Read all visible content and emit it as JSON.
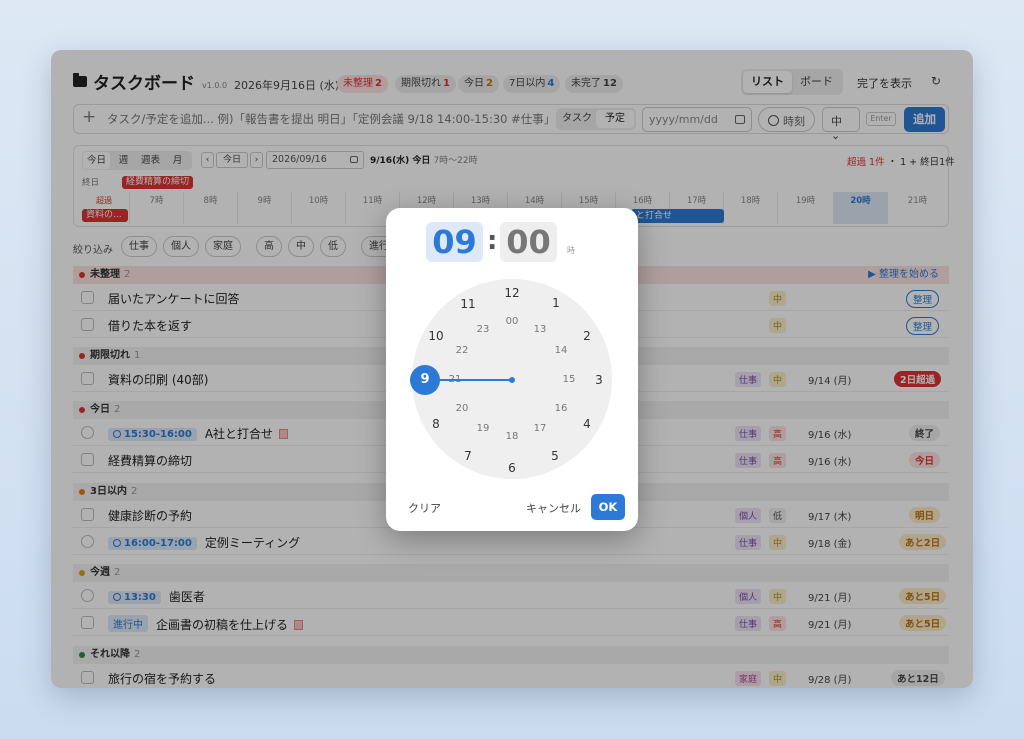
{
  "header": {
    "title": "タスクボード",
    "version": "v1.0.0",
    "date": "2026年9月16日 (水)",
    "chips": [
      {
        "label": "未整理",
        "count": "2"
      },
      {
        "label": "期限切れ",
        "count": "1"
      },
      {
        "label": "今日",
        "count": "2"
      },
      {
        "label": "7日以内",
        "count": "4"
      },
      {
        "label": "未完了",
        "count": "12"
      }
    ],
    "view_list": "リスト",
    "view_board": "ボード",
    "show_done": "完了を表示",
    "refresh_icon": "↻"
  },
  "addbar": {
    "plus": "+",
    "placeholder": "タスク/予定を追加... 例)「報告書を提出 明日」「定例会議 9/18 14:00-15:30 #仕事」",
    "type_task": "タスク",
    "type_event": "予定",
    "date_placeholder": "yyyy/mm/dd",
    "time_label": "時刻",
    "priority": "中",
    "enter_hint": "Enter",
    "add_button": "追加"
  },
  "timeline": {
    "tabs": [
      "今日",
      "週",
      "週表",
      "月"
    ],
    "prev": "‹",
    "today_btn": "今日",
    "next": "›",
    "date_value": "2026/09/16",
    "today_label": "9/16(水) 今日",
    "hours_range": "7時〜22時",
    "overdue_summary_red": "超過 1件",
    "overdue_summary_rest": " ・ 1 + 終日1件",
    "allday_label": "終日",
    "allday_event": "経費精算の締切",
    "overdue_label": "超過",
    "overdue_event": "資料の...",
    "hours": [
      "7時",
      "8時",
      "9時",
      "10時",
      "11時",
      "12時",
      "13時",
      "14時",
      "15時",
      "16時",
      "17時",
      "18時",
      "19時",
      "20時",
      "21時"
    ],
    "blue_event": "と打合せ"
  },
  "filters": {
    "label": "絞り込み",
    "chips": [
      "仕事",
      "個人",
      "家庭",
      "高",
      "中",
      "低",
      "進行"
    ]
  },
  "sections": [
    {
      "title": "未整理",
      "count": "2",
      "action": "▶ 整理を始める"
    },
    {
      "title": "期限切れ",
      "count": "1"
    },
    {
      "title": "今日",
      "count": "2"
    },
    {
      "title": "3日以内",
      "count": "2"
    },
    {
      "title": "今週",
      "count": "2"
    },
    {
      "title": "それ以降",
      "count": "2"
    }
  ],
  "rows": {
    "r1": {
      "title": "届いたアンケートに回答",
      "priority": "中",
      "badge": "整理"
    },
    "r2": {
      "title": "借りた本を返す",
      "priority": "中",
      "badge": "整理"
    },
    "r3": {
      "title": "資料の印刷 (40部)",
      "tag": "仕事",
      "priority": "中",
      "date": "9/14 (月)",
      "badge": "2日超過"
    },
    "r4": {
      "time": "15:30-16:00",
      "title": "A社と打合せ",
      "tag": "仕事",
      "priority": "高",
      "date": "9/16 (水)",
      "badge": "終了"
    },
    "r5": {
      "title": "経費精算の締切",
      "tag": "仕事",
      "priority": "高",
      "date": "9/16 (水)",
      "badge": "今日"
    },
    "r6": {
      "title": "健康診断の予約",
      "tag": "個人",
      "priority": "低",
      "date": "9/17 (木)",
      "badge": "明日"
    },
    "r7": {
      "time": "16:00-17:00",
      "title": "定例ミーティング",
      "tag": "仕事",
      "priority": "中",
      "date": "9/18 (金)",
      "badge": "あと2日"
    },
    "r8": {
      "time": "13:30",
      "title": "歯医者",
      "tag": "個人",
      "priority": "中",
      "date": "9/21 (月)",
      "badge": "あと5日"
    },
    "r9": {
      "status": "進行中",
      "title": "企画書の初稿を仕上げる",
      "tag": "仕事",
      "priority": "高",
      "date": "9/21 (月)",
      "badge": "あと5日"
    },
    "r10": {
      "title": "旅行の宿を予約する",
      "tag": "家庭",
      "priority": "中",
      "date": "9/28 (月)",
      "badge": "あと12日"
    }
  },
  "picker": {
    "hour": "09",
    "colon": ":",
    "minute": "00",
    "unit": "時",
    "selected": "9",
    "outer": [
      "12",
      "1",
      "2",
      "3",
      "4",
      "5",
      "6",
      "7",
      "8",
      "10",
      "11"
    ],
    "inner": [
      "00",
      "13",
      "14",
      "15",
      "16",
      "17",
      "18",
      "19",
      "20",
      "21",
      "22",
      "23"
    ],
    "clear": "クリア",
    "cancel": "キャンセル",
    "ok": "OK"
  },
  "colors": {
    "accent": "#2d7ad6",
    "danger": "#dd3333",
    "backdrop": "#cbdcf0"
  }
}
